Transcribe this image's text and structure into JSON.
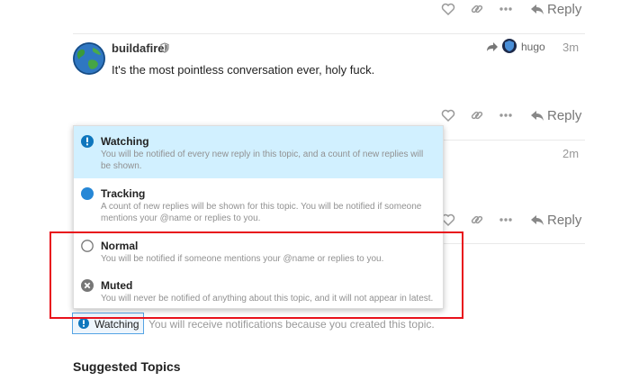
{
  "top_actions": {
    "reply_label": "Reply"
  },
  "post": {
    "username": "buildafire",
    "reply_to_user": "hugo",
    "time": "3m",
    "body": "It's the most pointless conversation ever, holy fuck.",
    "reply_label": "Reply"
  },
  "hidden_post": {
    "time": "2m",
    "reply_label": "Reply"
  },
  "notification_menu": {
    "options": [
      {
        "title": "Watching",
        "description": "You will be notified of every new reply in this topic, and a count of new replies will be shown."
      },
      {
        "title": "Tracking",
        "description": "A count of new replies will be shown for this topic. You will be notified if someone mentions your @name or replies to you."
      },
      {
        "title": "Normal",
        "description": "You will be notified if someone mentions your @name or replies to you."
      },
      {
        "title": "Muted",
        "description": "You will never be notified of anything about this topic, and it will not appear in latest."
      }
    ]
  },
  "notification_footer": {
    "button_label": "Watching",
    "reason": "You will receive notifications because you created this topic."
  },
  "suggested_topics": {
    "heading": "Suggested Topics"
  },
  "colors": {
    "watching_bg": "#d1f0ff",
    "accent_blue": "#0e76bd",
    "highlight_red": "#e8121c"
  }
}
